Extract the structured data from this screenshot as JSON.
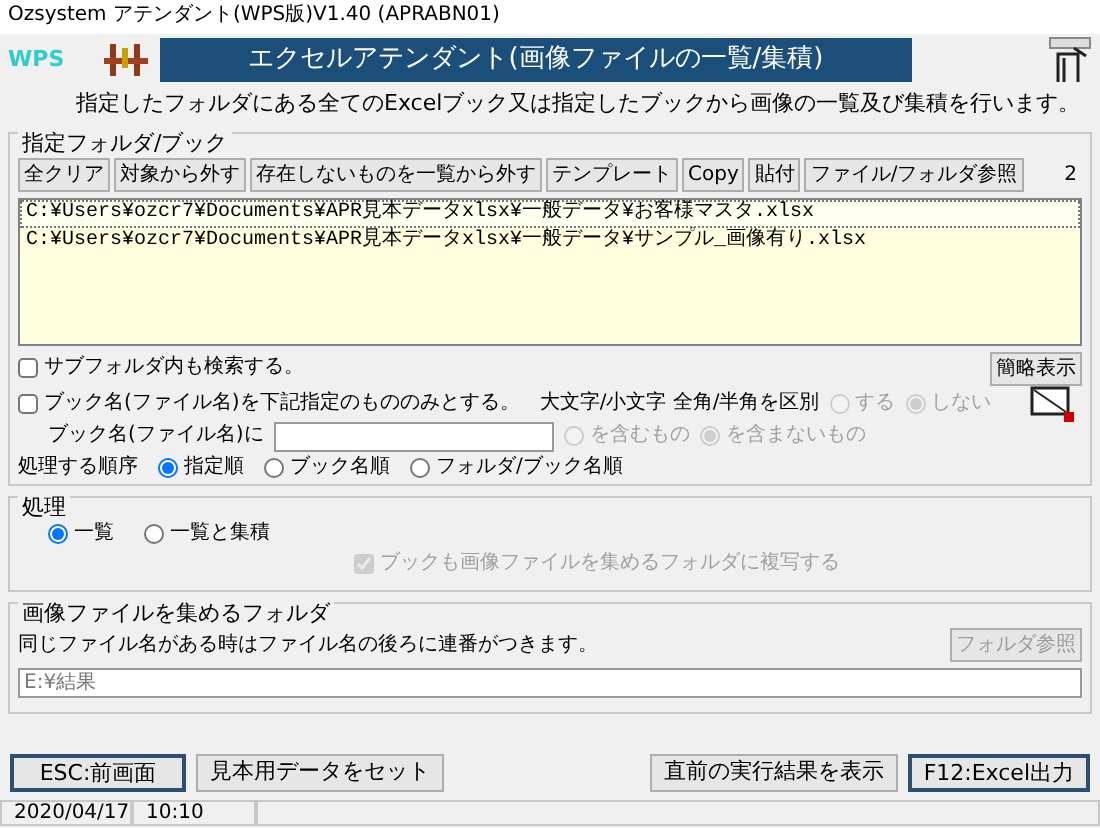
{
  "window": {
    "title": "Ozsystem アテンダント(WPS版)V1.40 (APRABN01)"
  },
  "header": {
    "logo": "WPS",
    "banner": "エクセルアテンダント(画像ファイルの一覧/集積)",
    "description": "指定したフォルダにある全てのExcelブック又は指定したブックから画像の一覧及び集積を行います。"
  },
  "target": {
    "legend": "指定フォルダ/ブック",
    "toolbar": [
      "全クリア",
      "対象から外す",
      "存在しないものを一覧から外す",
      "テンプレート",
      "Copy",
      "貼付",
      "ファイル/フォルダ参照"
    ],
    "count": "2",
    "files": [
      {
        "path": "C:¥Users¥ozcr7¥Documents¥APR見本データxlsx¥一般データ¥お客様マスタ.xlsx",
        "selected": true
      },
      {
        "path": "C:¥Users¥ozcr7¥Documents¥APR見本データxlsx¥一般データ¥サンプル_画像有り.xlsx",
        "selected": false
      }
    ],
    "options": [
      {
        "label": "サブフォルダ内も検索する。",
        "checked": false
      },
      {
        "label": "ブック名(ファイル名)を下記指定のもののみとする。",
        "checked": false
      }
    ],
    "brief_button": "簡略表示",
    "case_label": "大文字/小文字 全角/半角を区別",
    "case_options": [
      {
        "label": "する",
        "selected": false,
        "disabled": true
      },
      {
        "label": "しない",
        "selected": true,
        "disabled": true
      }
    ],
    "name_label": "ブック名(ファイル名)に",
    "name_options": [
      {
        "label": "を含むもの",
        "selected": false,
        "disabled": true
      },
      {
        "label": "を含まないもの",
        "selected": true,
        "disabled": true
      }
    ],
    "order_label": "処理する順序",
    "order_options": [
      {
        "label": "指定順",
        "selected": true
      },
      {
        "label": "ブック名順",
        "selected": false
      },
      {
        "label": "フォルダ/ブック名順",
        "selected": false
      }
    ]
  },
  "process": {
    "legend": "処理",
    "options": [
      {
        "label": "一覧",
        "selected": true
      },
      {
        "label": "一覧と集積",
        "selected": false
      }
    ],
    "copy_option": {
      "label": "ブックも画像ファイルを集めるフォルダに複写する",
      "checked": true,
      "disabled": true
    }
  },
  "output": {
    "legend": "画像ファイルを集めるフォルダ",
    "note": "同じファイル名がある時はファイル名の後ろに連番がつきます。",
    "browse_button": {
      "label": "フォルダ参照",
      "disabled": true
    },
    "path": "E:¥結果"
  },
  "buttons": [
    {
      "label": "ESC:前画面",
      "emphasized": true
    },
    {
      "label": "見本用データをセット",
      "emphasized": false
    },
    {
      "label": "直前の実行結果を表示",
      "emphasized": false
    },
    {
      "label": "F12:Excel出力",
      "emphasized": true
    }
  ],
  "status_bar": [
    "2020/04/17",
    "10:10"
  ]
}
